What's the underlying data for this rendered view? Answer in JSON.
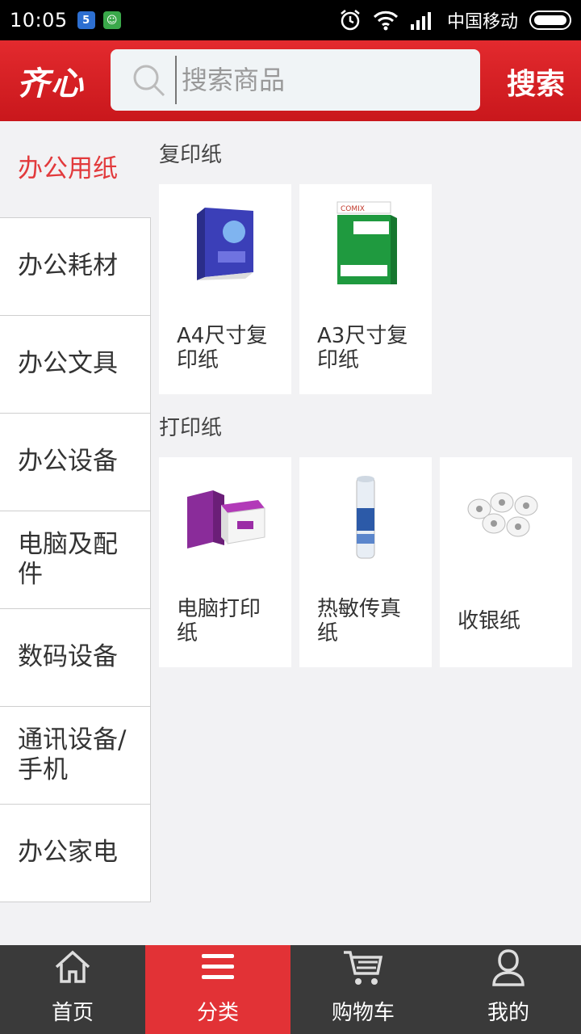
{
  "status_bar": {
    "time": "10:05",
    "carrier": "中国移动",
    "icons": [
      "notification-badge-icon",
      "android-icon",
      "alarm-icon",
      "wifi-icon",
      "signal-icon",
      "battery-icon"
    ]
  },
  "header": {
    "logo": "齐心",
    "search_placeholder": "搜索商品",
    "search_button": "搜索",
    "brand_color": "#d91f24"
  },
  "sidebar": {
    "items": [
      {
        "label": "办公用纸",
        "active": true
      },
      {
        "label": "办公耗材",
        "active": false
      },
      {
        "label": "办公文具",
        "active": false
      },
      {
        "label": "办公设备",
        "active": false
      },
      {
        "label": "电脑及配件",
        "active": false
      },
      {
        "label": "数码设备",
        "active": false
      },
      {
        "label": "通讯设备/手机",
        "active": false
      },
      {
        "label": "办公家电",
        "active": false
      }
    ]
  },
  "content": {
    "sections": [
      {
        "title": "复印纸",
        "products": [
          {
            "name": "A4尺寸复印纸",
            "icon": "paper-ream-blue-icon"
          },
          {
            "name": "A3尺寸复印纸",
            "icon": "paper-ream-green-icon"
          }
        ]
      },
      {
        "title": "打印纸",
        "products": [
          {
            "name": "电脑打印纸",
            "icon": "printer-paper-box-icon"
          },
          {
            "name": "热敏传真纸",
            "icon": "fax-paper-roll-icon"
          },
          {
            "name": "收银纸",
            "icon": "receipt-rolls-icon"
          }
        ]
      }
    ]
  },
  "bottom_nav": {
    "tabs": [
      {
        "label": "首页",
        "icon": "home-icon",
        "active": false
      },
      {
        "label": "分类",
        "icon": "menu-icon",
        "active": true
      },
      {
        "label": "购物车",
        "icon": "cart-icon",
        "active": false
      },
      {
        "label": "我的",
        "icon": "user-icon",
        "active": false
      }
    ],
    "active_color": "#e23236"
  }
}
